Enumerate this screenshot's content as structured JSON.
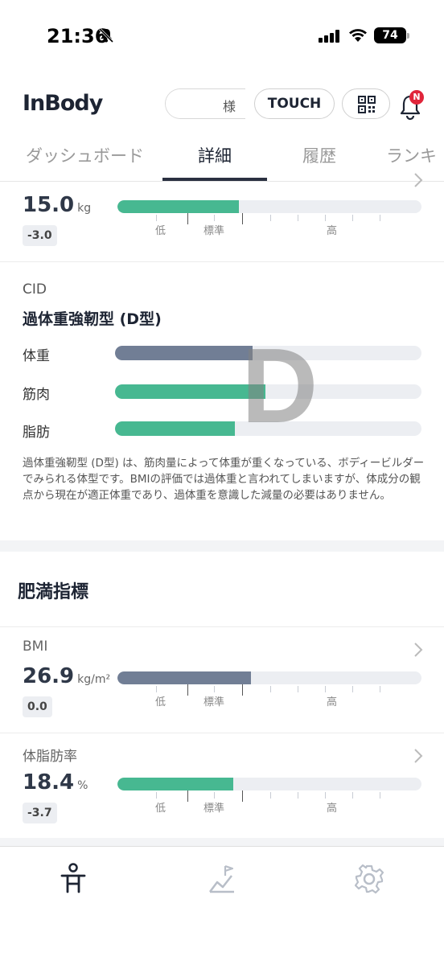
{
  "status_bar": {
    "time": "21:36",
    "battery": "74"
  },
  "header": {
    "logo": "InBody",
    "user_suffix": "様",
    "touch_label": "TOUCH",
    "notification_badge": "N"
  },
  "tabs": [
    {
      "label": "ダッシュボード",
      "active": false
    },
    {
      "label": "詳細",
      "active": true
    },
    {
      "label": "履歴",
      "active": false
    },
    {
      "label": "ランキ",
      "active": false
    }
  ],
  "top_metric": {
    "value": "15.0",
    "unit": "kg",
    "delta": "-3.0",
    "fill_percent": 40,
    "scale": {
      "low": "低",
      "standard": "標準",
      "high": "高"
    }
  },
  "cid": {
    "title": "CID",
    "type": "過体重強靭型 (D型)",
    "letter": "D",
    "rows": [
      {
        "label": "体重",
        "fill_percent": 45,
        "color": "#717e95"
      },
      {
        "label": "筋肉",
        "fill_percent": 49,
        "color": "#47b891"
      },
      {
        "label": "脂肪",
        "fill_percent": 39,
        "color": "#47b891"
      }
    ],
    "description": "過体重強靭型 (D型) は、筋肉量によって体重が重くなっている、ボディービルダーでみられる体型です。BMIの評価では過体重と言われてしまいますが、体成分の観点から現在が適正体重であり、過体重を意識した減量の必要はありません。"
  },
  "obesity": {
    "heading": "肥満指標",
    "bmi": {
      "label": "BMI",
      "value": "26.9",
      "unit": "kg/m²",
      "delta": "0.0",
      "fill_percent": 44,
      "color": "#717e95"
    },
    "body_fat": {
      "label": "体脂肪率",
      "value": "18.4",
      "unit": "%",
      "delta": "-3.7",
      "fill_percent": 38,
      "color": "#47b891"
    },
    "scale": {
      "low": "低",
      "standard": "標準",
      "high": "高"
    }
  },
  "bottom_nav": [
    {
      "icon": "body-icon",
      "active": true
    },
    {
      "icon": "goal-chart-icon",
      "active": false
    },
    {
      "icon": "gear-icon",
      "active": false
    }
  ]
}
